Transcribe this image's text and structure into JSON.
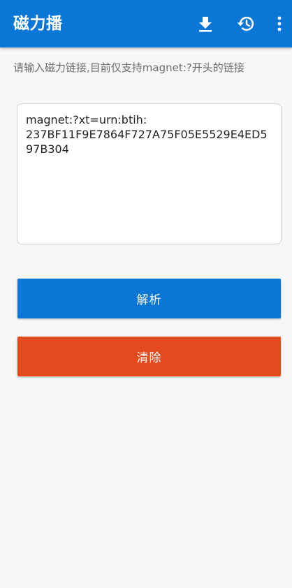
{
  "app_bar": {
    "title": "磁力播",
    "background_color": "#0a77d6",
    "actions": [
      {
        "icon": "download-icon",
        "label": "下载"
      },
      {
        "icon": "history-icon",
        "label": "历史"
      },
      {
        "icon": "more-vert-icon",
        "label": "更多"
      }
    ]
  },
  "main": {
    "hint": "请输入磁力链接,目前仅支持magnet:?开头的链接",
    "magnet_input": {
      "value": "magnet:?xt=urn:btih:\n237BF11F9E7864F727A75F05E5529E4ED597B304",
      "placeholder": ""
    },
    "parse_button": {
      "label": "解析",
      "color": "#0a77d6"
    },
    "clear_button": {
      "label": "清除",
      "color": "#e54a1e"
    }
  }
}
